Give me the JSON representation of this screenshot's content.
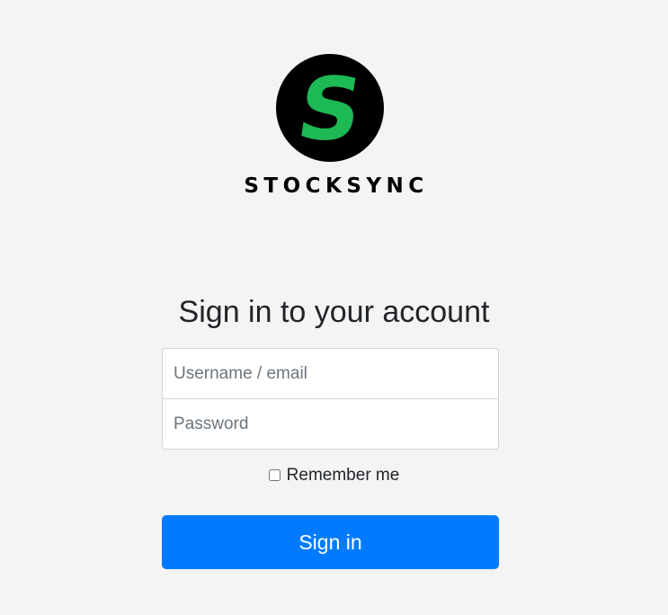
{
  "brand": {
    "logo_letter": "S",
    "wordmark": "STOCKSYNC",
    "logo_icon": "stocksync-s-logo-icon",
    "accent_color": "#1db954",
    "circle_color": "#000000"
  },
  "form": {
    "title": "Sign in to your account",
    "username": {
      "placeholder": "Username / email",
      "value": ""
    },
    "password": {
      "placeholder": "Password",
      "value": ""
    },
    "remember": {
      "label": "Remember me",
      "checked": false
    },
    "submit_label": "Sign in",
    "submit_color": "#007bff"
  }
}
